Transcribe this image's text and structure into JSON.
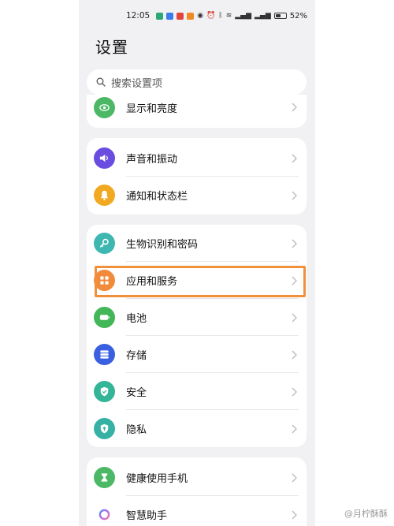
{
  "status_bar": {
    "time": "12:05",
    "battery_percent": "52%",
    "battery_level": 0.52,
    "app_icon_colors": [
      "#2aa876",
      "#3b7bea",
      "#e0463b",
      "#f08a24"
    ]
  },
  "page": {
    "title": "设置",
    "search_placeholder": "搜索设置项"
  },
  "groups": [
    {
      "items": [
        {
          "label": "显示和亮度",
          "icon": "eye-icon",
          "color": "#4cb866"
        }
      ]
    },
    {
      "items": [
        {
          "label": "声音和振动",
          "icon": "speaker-icon",
          "color": "#6a4ce0"
        },
        {
          "label": "通知和状态栏",
          "icon": "bell-icon",
          "color": "#f2a922"
        }
      ]
    },
    {
      "items": [
        {
          "label": "生物识别和密码",
          "icon": "key-icon",
          "color": "#3fb7b1"
        },
        {
          "label": "应用和服务",
          "icon": "apps-grid-icon",
          "color": "#f28a3b",
          "highlighted": true
        },
        {
          "label": "电池",
          "icon": "battery-icon",
          "color": "#43b657"
        },
        {
          "label": "存储",
          "icon": "storage-icon",
          "color": "#3a5fe0"
        },
        {
          "label": "安全",
          "icon": "shield-check-icon",
          "color": "#35b597"
        },
        {
          "label": "隐私",
          "icon": "privacy-shield-icon",
          "color": "#36b2a4"
        }
      ]
    },
    {
      "items": [
        {
          "label": "健康使用手机",
          "icon": "hourglass-icon",
          "color": "#4cb866"
        },
        {
          "label": "智慧助手",
          "icon": "assistant-ring-icon",
          "color": "#8e6bef"
        }
      ]
    }
  ],
  "highlight_color": "#f28f3b",
  "watermark": "@月柠酥酥"
}
